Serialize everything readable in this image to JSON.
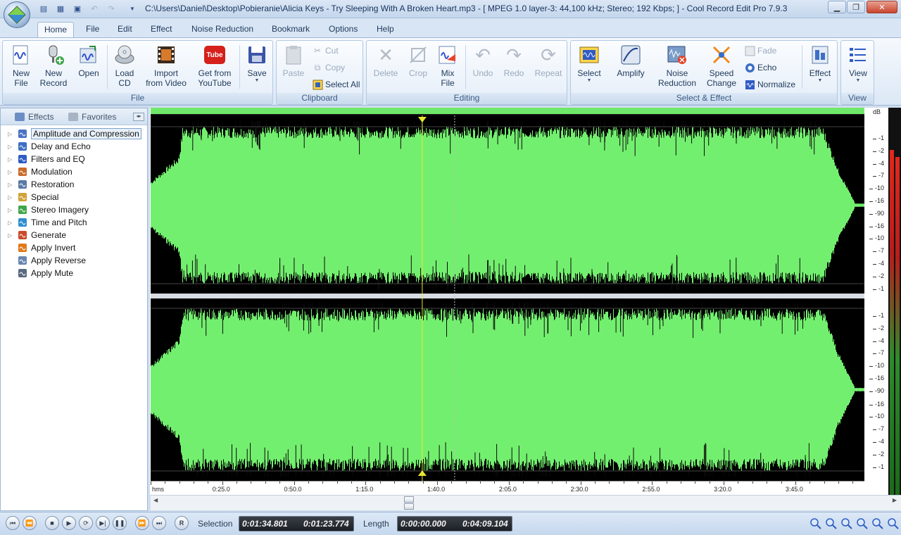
{
  "titlebar": {
    "title": "C:\\Users\\Daniel\\Desktop\\Pobieranie\\Alicia Keys - Try Sleeping With A Broken Heart.mp3 - [ MPEG 1.0 layer-3: 44,100 kHz; Stereo; 192 Kbps;  ] - Cool Record Edit Pro 7.9.3"
  },
  "menu": {
    "tabs": [
      {
        "label": "Home"
      },
      {
        "label": "File"
      },
      {
        "label": "Edit"
      },
      {
        "label": "Effect"
      },
      {
        "label": "Noise Reduction"
      },
      {
        "label": "Bookmark"
      },
      {
        "label": "Options"
      },
      {
        "label": "Help"
      }
    ],
    "active_tab": "Home"
  },
  "ribbon": {
    "groups": {
      "file": "File",
      "clipboard": "Clipboard",
      "editing": "Editing",
      "select_effect": "Select & Effect",
      "view": "View"
    },
    "buttons": {
      "new_file": "New\nFile",
      "new_record": "New\nRecord",
      "open": "Open",
      "load_cd": "Load\nCD",
      "import_video": "Import\nfrom Video",
      "youtube": "Get from\nYouTube",
      "youtube_logo": "Tube",
      "save": "Save",
      "paste": "Paste",
      "cut": "Cut",
      "copy": "Copy",
      "select_all": "Select All",
      "delete": "Delete",
      "crop": "Crop",
      "mix_file": "Mix\nFile",
      "undo": "Undo",
      "redo": "Redo",
      "repeat": "Repeat",
      "select": "Select",
      "amplify": "Amplify",
      "noise_reduction": "Noise\nReduction",
      "speed_change": "Speed\nChange",
      "fade": "Fade",
      "echo": "Echo",
      "normalize": "Normalize",
      "effect": "Effect",
      "view": "View"
    }
  },
  "left_panel": {
    "tabs": {
      "effects": "Effects",
      "favorites": "Favorites"
    },
    "tree": [
      {
        "label": "Amplitude and Compression",
        "expandable": true,
        "selected": true,
        "icon": "amplitude-icon"
      },
      {
        "label": "Delay and Echo",
        "expandable": true,
        "icon": "delay-icon"
      },
      {
        "label": "Filters and EQ",
        "expandable": true,
        "icon": "filter-icon"
      },
      {
        "label": "Modulation",
        "expandable": true,
        "icon": "modulation-icon"
      },
      {
        "label": "Restoration",
        "expandable": true,
        "icon": "restoration-icon"
      },
      {
        "label": "Special",
        "expandable": true,
        "icon": "special-icon"
      },
      {
        "label": "Stereo Imagery",
        "expandable": true,
        "icon": "stereo-icon"
      },
      {
        "label": "Time and Pitch",
        "expandable": true,
        "icon": "time-pitch-icon"
      },
      {
        "label": "Generate",
        "expandable": true,
        "icon": "generate-icon"
      },
      {
        "label": "Apply Invert",
        "expandable": false,
        "icon": "invert-icon"
      },
      {
        "label": "Apply Reverse",
        "expandable": false,
        "icon": "reverse-icon"
      },
      {
        "label": "Apply Mute",
        "expandable": false,
        "icon": "mute-icon"
      }
    ]
  },
  "waveform": {
    "colors": {
      "wave": "#73ef6f",
      "background": "#000000",
      "cursor": "#e8e62f"
    },
    "db_unit": "dB",
    "db_ticks": [
      "-1",
      "-2",
      "-4",
      "-7",
      "-10",
      "-16",
      "-90",
      "-16",
      "-10",
      "-7",
      "-4",
      "-2",
      "-1"
    ],
    "time_unit": "hms",
    "time_ticks": [
      "0:25.0",
      "0:50.0",
      "1:15.0",
      "1:40.0",
      "2:05.0",
      "2:30.0",
      "2:55.0",
      "3:20.0",
      "3:45.0"
    ]
  },
  "transport": {
    "selection_label": "Selection",
    "selection_start": "0:01:34.801",
    "selection_length": "0:01:23.774",
    "length_label": "Length",
    "length_start": "0:00:00.000",
    "length_total": "0:04:09.104",
    "record_label": "R"
  }
}
